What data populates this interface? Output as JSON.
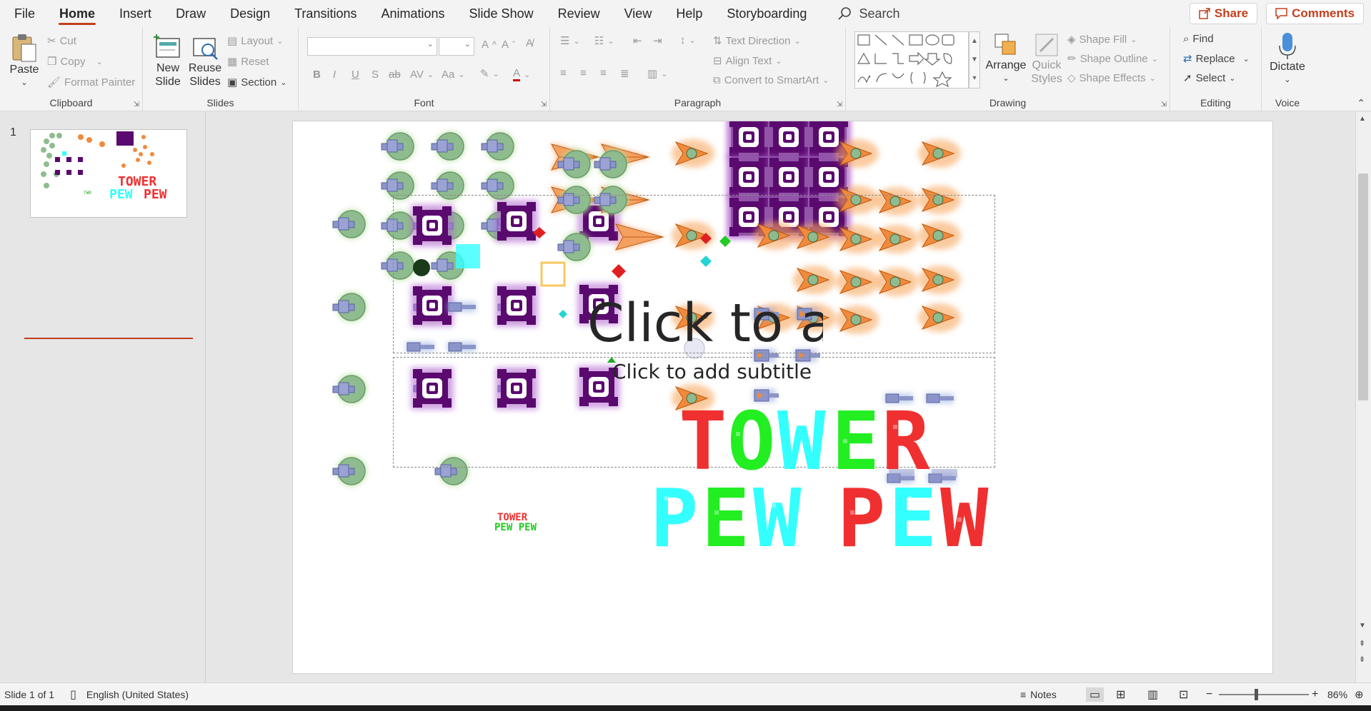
{
  "menu": {
    "items": [
      "File",
      "Home",
      "Insert",
      "Draw",
      "Design",
      "Transitions",
      "Animations",
      "Slide Show",
      "Review",
      "View",
      "Help",
      "Storyboarding"
    ],
    "active": "Home",
    "search_label": "Search",
    "share_label": "Share",
    "comments_label": "Comments"
  },
  "ribbon": {
    "clipboard": {
      "paste": "Paste",
      "cut": "Cut",
      "copy": "Copy",
      "format_painter": "Format Painter",
      "label": "Clipboard"
    },
    "slides": {
      "new_slide_1": "New",
      "new_slide_2": "Slide",
      "reuse_1": "Reuse",
      "reuse_2": "Slides",
      "layout": "Layout",
      "reset": "Reset",
      "section": "Section",
      "label": "Slides"
    },
    "font": {
      "label": "Font",
      "bold": "B",
      "italic": "I",
      "underline": "U",
      "shadow": "S",
      "strike": "ab",
      "spacing": "AV",
      "case": "Aa"
    },
    "paragraph": {
      "text_direction": "Text Direction",
      "align_text": "Align Text",
      "convert_smartart": "Convert to SmartArt",
      "label": "Paragraph"
    },
    "drawing": {
      "arrange": "Arrange",
      "quick_styles_1": "Quick",
      "quick_styles_2": "Styles",
      "shape_fill": "Shape Fill",
      "shape_outline": "Shape Outline",
      "shape_effects": "Shape Effects",
      "label": "Drawing"
    },
    "editing": {
      "find": "Find",
      "replace": "Replace",
      "select": "Select",
      "label": "Editing"
    },
    "voice": {
      "dictate": "Dictate",
      "label": "Voice"
    }
  },
  "thumbnails": [
    {
      "number": "1"
    }
  ],
  "slide": {
    "title_placeholder": "Click to add title",
    "subtitle_placeholder": "Click to add subtitle",
    "logo_line1": "TOWER",
    "logo_line2": "PEW PEW"
  },
  "status": {
    "slide_info": "Slide 1 of 1",
    "language": "English (United States)",
    "notes": "Notes",
    "zoom": "86%"
  },
  "colors": {
    "accent": "#c43e1c",
    "tower_green": "#8fbc8f",
    "ship_orange": "#f08a3c",
    "block_purple": "#5a0a6e",
    "red": "#f03030",
    "cyan": "#33ffff",
    "green": "#22ee22"
  }
}
